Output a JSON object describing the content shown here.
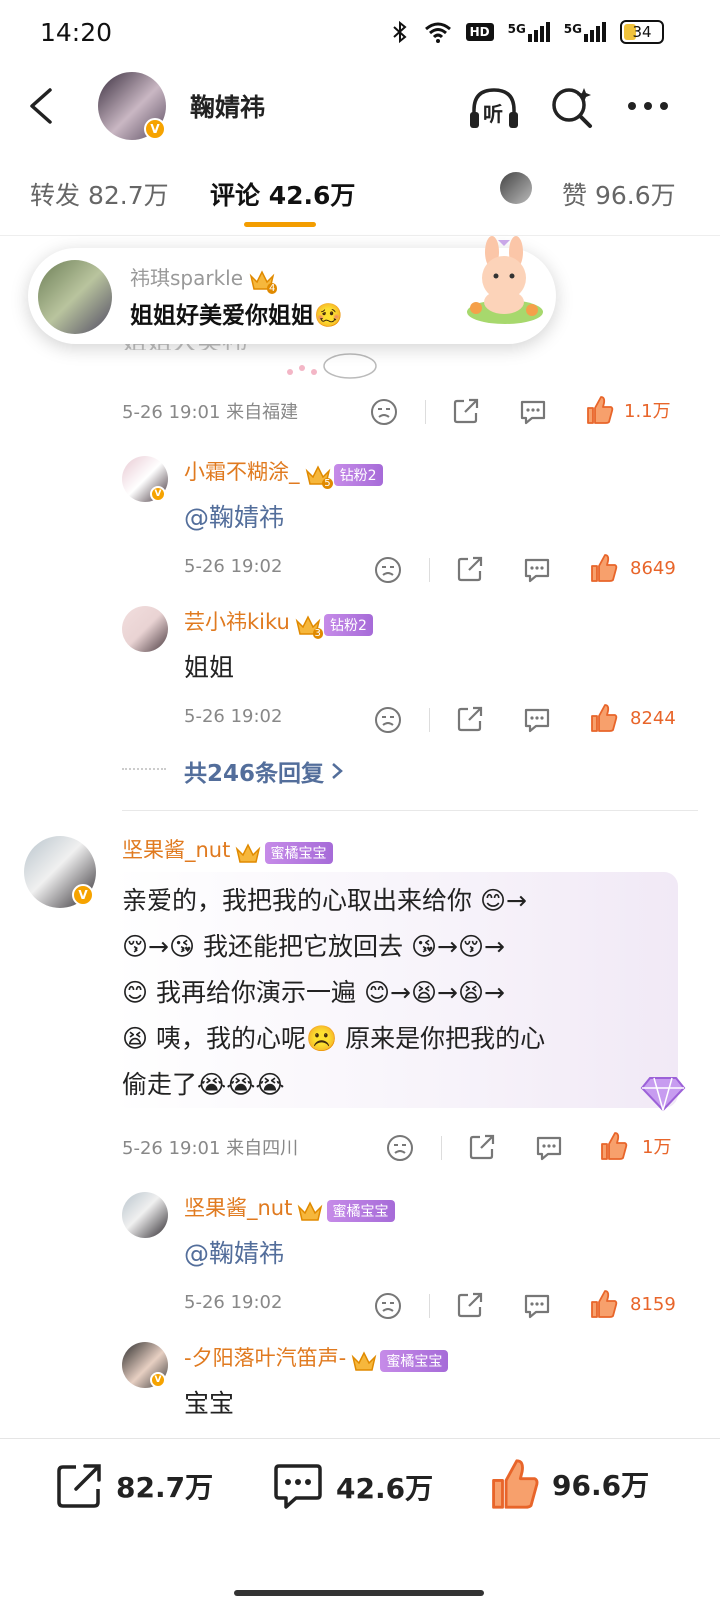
{
  "status": {
    "time": "14:20",
    "battery": "34",
    "network1": "5G",
    "network2": "5G",
    "hd": "HD"
  },
  "header": {
    "title": "鞠婧祎",
    "listen_label": "听",
    "v_badge": "V"
  },
  "tabs": {
    "repost": "转发 82.7万",
    "comments": "评论 42.6万",
    "likes": "赞 96.6万"
  },
  "popup": {
    "name": "祎琪sparkle",
    "text": "姐姐好美爱你姐姐🥴",
    "crown_level": "4"
  },
  "partial_text": "姐姐大美祎",
  "comment1": {
    "time": "5-26 19:01 来自福建",
    "like_count": "1.1万"
  },
  "replies1": [
    {
      "name": "小霜不糊涂_",
      "tag": "钻粉2",
      "crown_level": "5",
      "text": "@鞠婧祎",
      "time": "5-26 19:02",
      "likes": "8649"
    },
    {
      "name": "芸小祎kiku",
      "tag": "钻粉2",
      "crown_level": "3",
      "text": "姐姐",
      "time": "5-26 19:02",
      "likes": "8244"
    }
  ],
  "more_replies": "共246条回复",
  "comment2": {
    "name": "坚果酱_nut",
    "tag": "蜜橘宝宝",
    "lines": [
      "亲爱的，我把我的心取出来给你 😊→",
      "😚→😘 我还能把它放回去 😘→😚→",
      "😊 我再给你演示一遍 😊→😫→😫→",
      "😫 咦，我的心呢☹️ 原来是你把我的心",
      "偷走了😭😭😭"
    ],
    "time": "5-26 19:01 来自四川",
    "like_count": "1万"
  },
  "replies2": [
    {
      "name": "坚果酱_nut",
      "tag": "蜜橘宝宝",
      "text": "@鞠婧祎",
      "time": "5-26 19:02",
      "likes": "8159"
    },
    {
      "name": "-夕阳落叶汽笛声-",
      "tag": "蜜橘宝宝",
      "text": "宝宝"
    }
  ],
  "bottom": {
    "reposts": "82.7万",
    "comments": "42.6万",
    "likes": "96.6万"
  },
  "colors": {
    "orange": "#e07a1f",
    "accent": "#f39d00",
    "like": "#e8652a",
    "link": "#536e9b",
    "tag": "#b67ae0"
  }
}
